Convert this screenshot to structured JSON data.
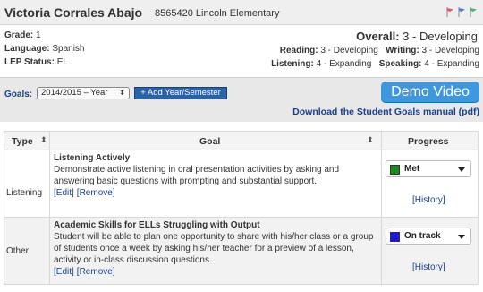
{
  "student": {
    "name": "Victoria Corrales Abajo",
    "id": "8565420",
    "school": "Lincoln Elementary"
  },
  "flags": {
    "colors": [
      "#e05a6b",
      "#4e7bd6",
      "#4fb46f"
    ]
  },
  "info": {
    "grade_label": "Grade:",
    "grade_value": "1",
    "language_label": "Language:",
    "language_value": "Spanish",
    "lep_label": "LEP Status:",
    "lep_value": "EL"
  },
  "overall": {
    "label": "Overall:",
    "value": "3 - Developing"
  },
  "scores": {
    "reading_label": "Reading:",
    "reading_value": "3 - Developing",
    "writing_label": "Writing:",
    "writing_value": "3 - Developing",
    "listening_label": "Listening:",
    "listening_value": "4 - Expanding",
    "speaking_label": "Speaking:",
    "speaking_value": "4 - Expanding"
  },
  "goals_bar": {
    "label": "Goals:",
    "year_selected": "2014/2015 – Year",
    "add_button": "+ Add Year/Semester",
    "demo_button": "Demo Video",
    "manual_link": "Download the Student Goals manual (pdf)"
  },
  "table": {
    "headers": {
      "type": "Type",
      "goal": "Goal",
      "progress": "Progress"
    },
    "sort_icon": "⬍",
    "rows": [
      {
        "type": "Listening",
        "title": "Listening Actively",
        "description": "Demonstrate active listening in oral presentation activities by asking and answering basic questions with prompting and substantial support.",
        "edit": "[Edit]",
        "remove": "[Remove]",
        "status": "Met",
        "status_color": "#1f8a1f",
        "history": "[History]"
      },
      {
        "type": "Other",
        "title": "Academic Skills for ELLs Struggling with Output",
        "description": "Student will be able to plan one opportunity to share with his/her class or a group of students once a week by asking his/her teacher for a preview of a lesson, activity or in-class discussion questions.",
        "edit": "[Edit]",
        "remove": "[Remove]",
        "status": "On track",
        "status_color": "#1a1ad6",
        "history": "[History]"
      }
    ]
  }
}
